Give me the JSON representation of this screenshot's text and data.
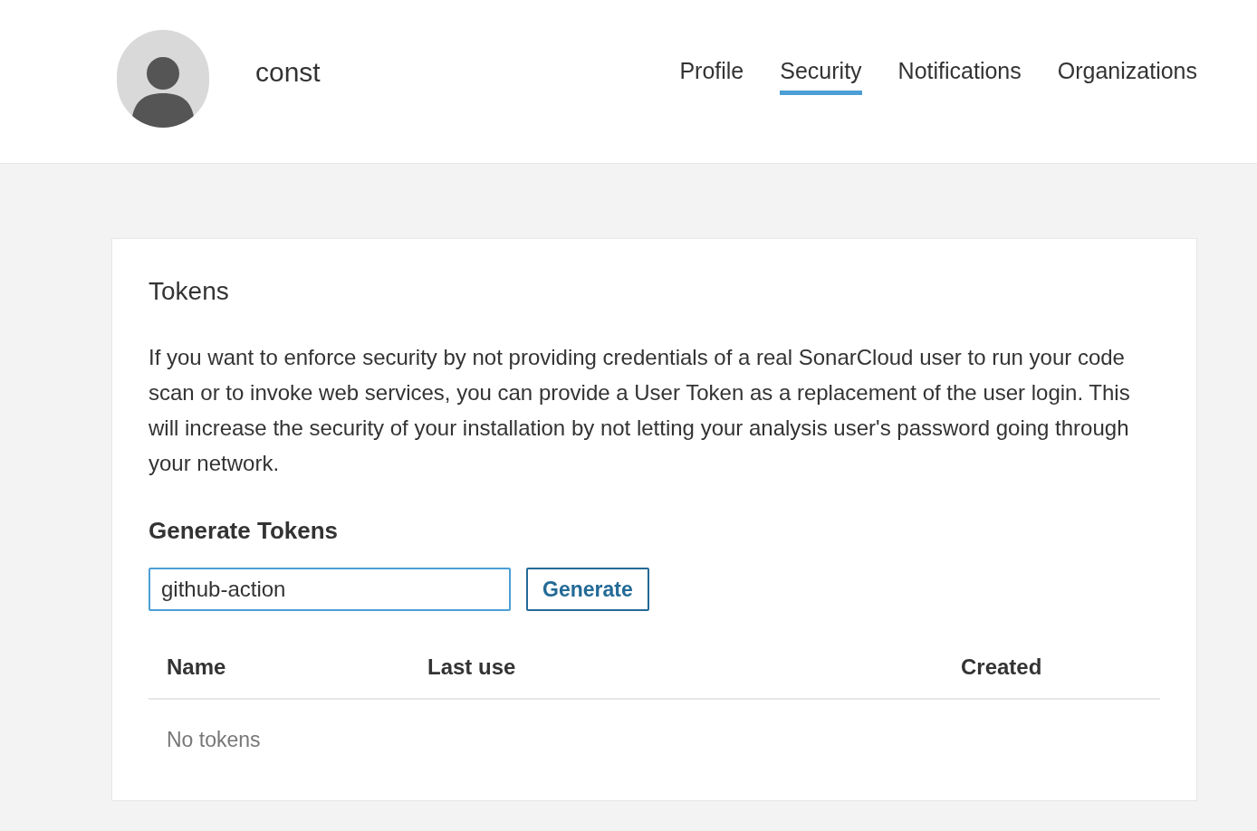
{
  "header": {
    "username": "const",
    "tabs": [
      {
        "label": "Profile",
        "selected": false
      },
      {
        "label": "Security",
        "selected": true
      },
      {
        "label": "Notifications",
        "selected": false
      },
      {
        "label": "Organizations",
        "selected": false
      }
    ]
  },
  "tokens": {
    "title": "Tokens",
    "description": "If you want to enforce security by not providing credentials of a real SonarCloud user to run your code scan or to invoke web services, you can provide a User Token as a replacement of the user login. This will increase the security of your installation by not letting your analysis user's password going through your network.",
    "generate_title": "Generate Tokens",
    "token_name_field": {
      "value": "github-action"
    },
    "generate_button": "Generate",
    "table": {
      "columns": [
        "Name",
        "Last use",
        "Created"
      ],
      "empty_text": "No tokens"
    }
  }
}
